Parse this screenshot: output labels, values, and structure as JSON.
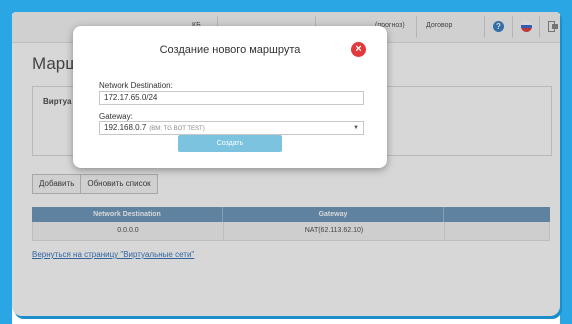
{
  "header": {
    "partial_text": "КБ",
    "prognoz_text": "(прогноз)",
    "contract_link": "Договор",
    "help_icon": "?",
    "language_icon": "ru-flag-icon",
    "exit_icon": "exit-icon"
  },
  "page": {
    "title": "Маршру",
    "panel_label": "Виртуа"
  },
  "toolbar": {
    "add_label": "Добавить",
    "refresh_label": "Обновить список"
  },
  "routes_table": {
    "columns": [
      "Network Destination",
      "Gateway"
    ],
    "rows": [
      {
        "destination": "0.0.0.0",
        "gateway": "NAT(62.113.62.10)"
      }
    ]
  },
  "back_link": "Вернуться на страницу \"Виртуальные сети\"",
  "modal": {
    "title": "Создание нового маршрута",
    "destination_label": "Network Destination:",
    "destination_value": "172.17.65.0/24",
    "gateway_label": "Gateway:",
    "gateway_value": "192.168.0.7",
    "gateway_sub": "(ВМ: TG BOT TEST)",
    "submit_label": "Создать"
  },
  "colors": {
    "frame": "#2aa6e4",
    "table_header": "#5b8ab5",
    "submit_button": "#7cc3e0",
    "close_button": "#e23a3a",
    "link": "#1a5fb4"
  }
}
